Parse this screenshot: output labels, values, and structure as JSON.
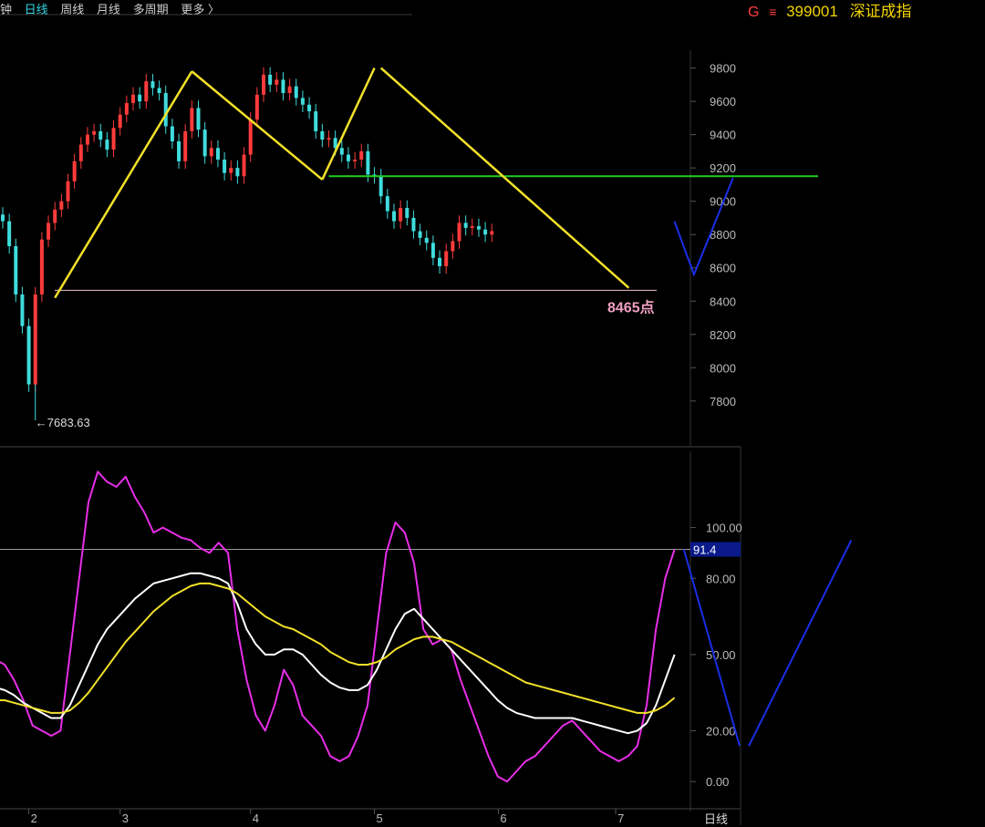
{
  "topbar": {
    "partial_left": "钟",
    "tabs": [
      "日线",
      "周线",
      "月线",
      "多周期",
      "更多 〉"
    ],
    "active_tab": "日线"
  },
  "instrument": {
    "g_label": "G",
    "menu_glyph": "≡",
    "code": "399001",
    "name": "深证成指"
  },
  "period_label": "日线",
  "colors": {
    "up": "#ff3b3b",
    "down": "#3fdcdc",
    "yellow": "#f2e12a",
    "green": "#22cc22",
    "blue": "#1a2ee6",
    "magenta": "#e82ee8",
    "white": "#ffffff",
    "pink_label": "#f0a0c0",
    "grid": "#333"
  },
  "chart_data": [
    {
      "type": "candlestick",
      "title": "",
      "ylim": [
        7580,
        9880
      ],
      "yticks": [
        9800,
        9600,
        9400,
        9200,
        9000,
        8800,
        8600,
        8400,
        8200,
        8000,
        7800
      ],
      "xticks": [
        {
          "label": "2",
          "index": 4
        },
        {
          "label": "3",
          "index": 18
        },
        {
          "label": "4",
          "index": 38
        },
        {
          "label": "5",
          "index": 57
        },
        {
          "label": "6",
          "index": 76
        },
        {
          "label": "7",
          "index": 94
        }
      ],
      "closes": [
        8880,
        8730,
        8440,
        8250,
        7900,
        8440,
        8770,
        8870,
        8950,
        9000,
        9120,
        9240,
        9340,
        9400,
        9420,
        9370,
        9310,
        9440,
        9520,
        9590,
        9640,
        9600,
        9720,
        9680,
        9650,
        9450,
        9360,
        9240,
        9420,
        9560,
        9430,
        9270,
        9320,
        9250,
        9170,
        9200,
        9150,
        9280,
        9490,
        9640,
        9760,
        9700,
        9730,
        9650,
        9690,
        9620,
        9580,
        9540,
        9420,
        9370,
        9380,
        9320,
        9280,
        9240,
        9250,
        9300,
        9160,
        9150,
        9030,
        8940,
        8880,
        8960,
        8900,
        8820,
        8780,
        8750,
        8660,
        8610,
        8700,
        8760,
        8870,
        8840,
        8850,
        8830,
        8800,
        8820
      ],
      "min_annotation": {
        "text": "7683.63",
        "value": 7683.63,
        "index": 5
      },
      "trend_lines": [
        {
          "name": "yellow-rise-1",
          "from": {
            "index": 8,
            "value": 8420
          },
          "to": {
            "index": 29,
            "value": 9780
          }
        },
        {
          "name": "yellow-fall-1",
          "from": {
            "index": 29,
            "value": 9780
          },
          "to": {
            "index": 49,
            "value": 9130
          }
        },
        {
          "name": "yellow-rise-2",
          "from": {
            "index": 49,
            "value": 9130
          },
          "to": {
            "index": 57,
            "value": 9800
          }
        },
        {
          "name": "yellow-fall-2",
          "from": {
            "index": 58,
            "value": 9800
          },
          "to": {
            "index": 96,
            "value": 8480
          }
        }
      ],
      "green_level": {
        "value": 9150,
        "from_index": 50
      },
      "support_level": {
        "value": 8465,
        "label": "8465点"
      },
      "projection_price": [
        {
          "index": 103,
          "value": 8880
        },
        {
          "index": 106,
          "value": 8560
        },
        {
          "index": 112,
          "value": 9140
        }
      ]
    },
    {
      "type": "line",
      "title": "",
      "ylim": [
        -10,
        130
      ],
      "yticks": [
        "100.00",
        "80.00",
        "50.00",
        "20.00",
        "0.00"
      ],
      "current_value_label": "91.4",
      "current_value": 91.4,
      "series": [
        {
          "key": "k",
          "color": "magenta",
          "values": [
            48,
            46,
            40,
            32,
            22,
            20,
            18,
            20,
            50,
            80,
            110,
            122,
            118,
            116,
            120,
            112,
            106,
            98,
            100,
            98,
            96,
            95,
            92,
            90,
            94,
            90,
            60,
            40,
            26,
            20,
            30,
            44,
            38,
            26,
            22,
            18,
            10,
            8,
            10,
            18,
            30,
            60,
            90,
            102,
            98,
            86,
            60,
            54,
            56,
            52,
            40,
            30,
            20,
            10,
            2,
            0,
            4,
            8,
            10,
            14,
            18,
            22,
            24,
            20,
            16,
            12,
            10,
            8,
            10,
            14,
            30,
            60,
            80,
            91.4
          ]
        },
        {
          "key": "d",
          "color": "white",
          "values": [
            37,
            36,
            34,
            31,
            29,
            27,
            25,
            25,
            30,
            38,
            46,
            54,
            60,
            64,
            68,
            72,
            75,
            78,
            79,
            80,
            81,
            82,
            82,
            81,
            80,
            78,
            70,
            60,
            54,
            50,
            50,
            52,
            52,
            50,
            46,
            42,
            39,
            37,
            36,
            36,
            38,
            44,
            52,
            60,
            66,
            68,
            64,
            60,
            56,
            52,
            48,
            44,
            40,
            36,
            32,
            29,
            27,
            26,
            25,
            25,
            25,
            25,
            25,
            24,
            23,
            22,
            21,
            20,
            19,
            20,
            23,
            30,
            40,
            50
          ]
        },
        {
          "key": "j",
          "color": "yellow",
          "values": [
            32,
            32,
            31,
            30,
            29,
            28,
            27,
            27,
            28,
            31,
            35,
            40,
            45,
            50,
            55,
            59,
            63,
            67,
            70,
            73,
            75,
            77,
            78,
            78,
            77,
            76,
            74,
            71,
            68,
            65,
            63,
            61,
            60,
            58,
            56,
            54,
            51,
            49,
            47,
            46,
            46,
            47,
            49,
            52,
            54,
            56,
            57,
            57,
            56,
            55,
            53,
            51,
            49,
            47,
            45,
            43,
            41,
            39,
            38,
            37,
            36,
            35,
            34,
            33,
            32,
            31,
            30,
            29,
            28,
            27,
            27,
            28,
            30,
            33
          ]
        }
      ],
      "projection": [
        {
          "index": 74,
          "value": 91.4
        },
        {
          "index": 80,
          "value": 14
        },
        {
          "index": 92,
          "value": 95
        }
      ]
    }
  ]
}
